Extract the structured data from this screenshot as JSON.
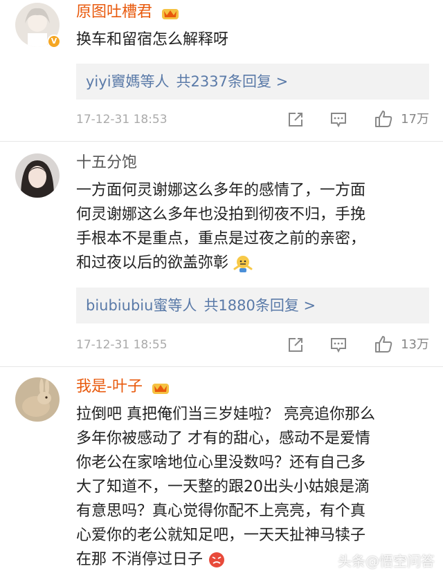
{
  "comments": [
    {
      "username": "原图吐槽君",
      "text_lines": [
        "换车和留宿怎么解释呀"
      ],
      "reply_names": "yiyi竇媽等人",
      "reply_count": "共2337条回复 >",
      "time": "17-12-31 18:53",
      "likes": "17万"
    },
    {
      "username": "十五分饱",
      "text_lines": [
        "一方面何灵谢娜这么多年的感情了，一方面",
        "何灵谢娜这么多年也没拍到彻夜不归，手挽",
        "手根本不是重点，重点是过夜之前的亲密，",
        "和过夜以后的欲盖弥彰"
      ],
      "reply_names": "biubiubiu蜜等人",
      "reply_count": "共1880条回复 >",
      "time": "17-12-31 18:55",
      "likes": "13万"
    },
    {
      "username": "我是-叶子",
      "text_lines": [
        "拉倒吧 真把俺们当三岁娃啦？ 亮亮追你那么",
        "多年你被感动了 才有的甜心，感动不是爱情",
        "你老公在家啥地位心里没数吗？还有自己多",
        "大了知道不，一天整的跟20出头小姑娘是滴",
        "有意思吗？真心觉得你配不上亮亮，有个真",
        "心爱你的老公就知足吧，一天天扯神马犊子",
        "在那 不消停过日子"
      ]
    }
  ],
  "watermark": "头条@悟空问答",
  "colors": {
    "vip_name": "#e8590c",
    "reply_link": "#5a7aa8",
    "reply_bg": "#f2f2f2"
  }
}
